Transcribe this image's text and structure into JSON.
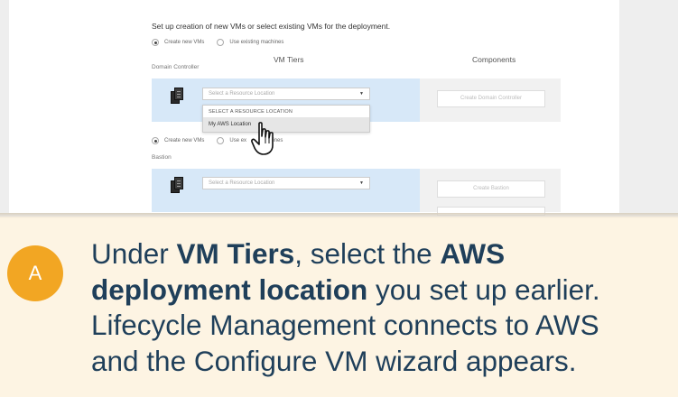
{
  "screenshot": {
    "intro_text": "Set up creation of new VMs or select existing VMs for the deployment.",
    "radio_options": {
      "create_new": "Create new VMs",
      "use_existing": "Use existing machines"
    },
    "second_radio_options": {
      "create_new": "Create new VMs",
      "use_existing": "Use ex",
      "use_existing_tail": "chines"
    },
    "columns": {
      "vm_tiers": "VM Tiers",
      "components": "Components"
    },
    "domain_controller": {
      "label": "Domain Controller",
      "select_placeholder": "Select a Resource Location",
      "button_label": "Create Domain Controller"
    },
    "dropdown": {
      "header": "SELECT A RESOURCE LOCATION",
      "items": [
        "My AWS Location"
      ]
    },
    "bastion": {
      "label": "Bastion",
      "select_placeholder": "Select a Resource Location",
      "button_label": "Create Bastion"
    },
    "icons": {
      "server": "server-icon",
      "caret": "chevron-down-icon",
      "cursor": "hand-pointer-icon"
    }
  },
  "callout": {
    "badge": "A",
    "line1_pre": "Under ",
    "line1_b1": "VM Tiers",
    "line1_mid": ", select the ",
    "line1_b2": "AWS",
    "line2_b": "deployment location",
    "line2_post": " you set up earlier.",
    "line3": "Lifecycle Management connects to AWS",
    "line4": "and the Configure VM wizard appears.",
    "colors": {
      "badge": "#f2a623",
      "text": "#1f3f5a",
      "background": "#fdf4e3"
    }
  }
}
